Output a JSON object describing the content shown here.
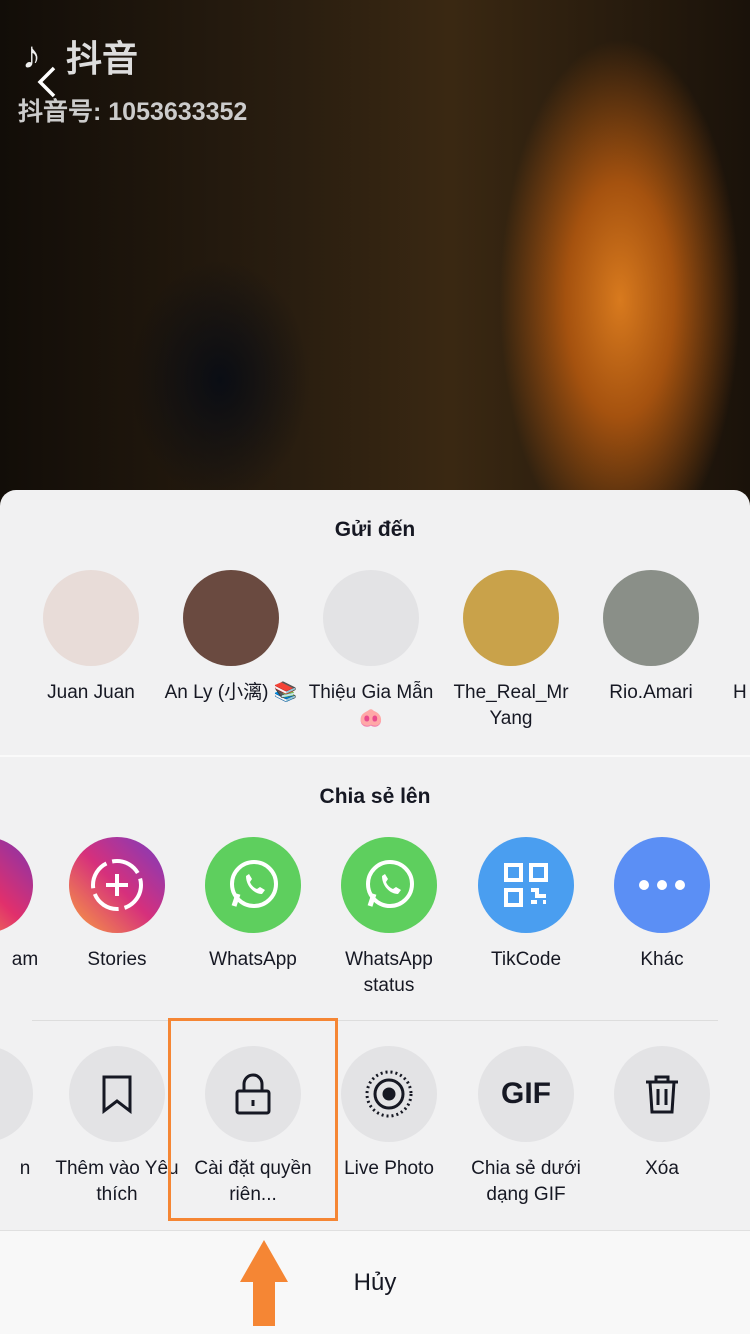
{
  "video": {
    "app_name": "抖音",
    "douyin_id": "抖音号: 1053633352"
  },
  "send_to": {
    "title": "Gửi đến",
    "contacts": [
      {
        "name": "Juan Juan"
      },
      {
        "name": "An Ly (小漓) 📚"
      },
      {
        "name": "Thiệu Gia Mẫn 🐽"
      },
      {
        "name": "The_Real_Mr Yang"
      },
      {
        "name": "Rio.Amari"
      },
      {
        "name": "H TR"
      }
    ]
  },
  "share_to": {
    "title": "Chia sẻ lên",
    "apps": [
      {
        "label": "am",
        "icon": "instagram-icon"
      },
      {
        "label": "Stories",
        "icon": "stories-icon"
      },
      {
        "label": "WhatsApp",
        "icon": "whatsapp-icon"
      },
      {
        "label": "WhatsApp status",
        "icon": "whatsapp-icon"
      },
      {
        "label": "TikCode",
        "icon": "qr-code-icon"
      },
      {
        "label": "Khác",
        "icon": "more-icon"
      }
    ]
  },
  "actions": [
    {
      "label": "n"
    },
    {
      "label": "Thêm vào Yêu thích",
      "icon": "bookmark-icon"
    },
    {
      "label": "Cài đặt quyền riên...",
      "icon": "lock-icon"
    },
    {
      "label": "Live Photo",
      "icon": "live-photo-icon"
    },
    {
      "label": "Chia sẻ dưới dạng GIF",
      "icon": "gif-icon",
      "glyph": "GIF"
    },
    {
      "label": "Xóa",
      "icon": "trash-icon"
    }
  ],
  "cancel_label": "Hủy",
  "colors": {
    "whatsapp": "#5ecf5e",
    "tikcode": "#4a9ef0",
    "more": "#5b8ff5",
    "highlight": "#f58634"
  }
}
